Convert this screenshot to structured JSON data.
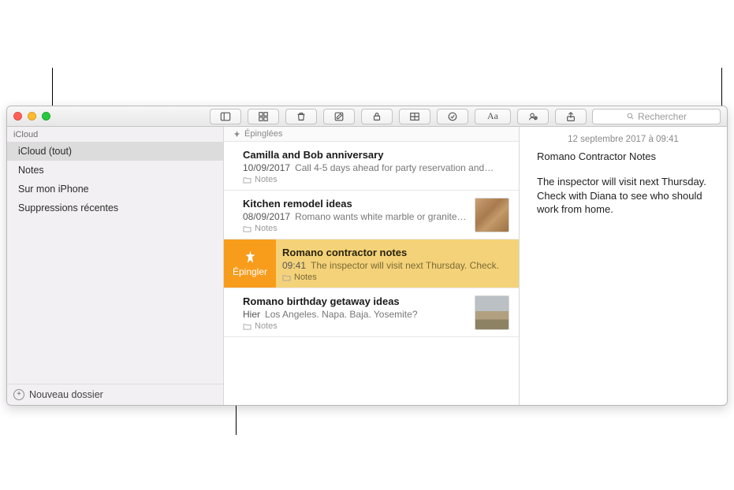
{
  "toolbar": {
    "search_placeholder": "Rechercher"
  },
  "sidebar": {
    "section_label": "iCloud",
    "items": [
      {
        "label": "iCloud (tout)",
        "selected": true
      },
      {
        "label": "Notes"
      },
      {
        "label": "Sur mon iPhone"
      },
      {
        "label": "Suppressions récentes"
      }
    ],
    "new_folder_label": "Nouveau dossier"
  },
  "list": {
    "pinned_header": "Épinglées",
    "items": [
      {
        "title": "Camilla and Bob anniversary",
        "date": "10/09/2017",
        "preview": "Call 4-5 days ahead for party reservation and…",
        "folder": "Notes"
      },
      {
        "title": "Kitchen remodel ideas",
        "date": "08/09/2017",
        "preview": "Romano wants white marble or granite…",
        "folder": "Notes",
        "thumb": "wood"
      },
      {
        "title": "Romano contractor notes",
        "date": "09:41",
        "preview": "The inspector will visit next Thursday. Check.",
        "folder": "Notes",
        "selected": true,
        "pin_action_label": "Épingler"
      },
      {
        "title": "Romano birthday getaway ideas",
        "date": "Hier",
        "preview": "Los Angeles. Napa. Baja. Yosemite?",
        "folder": "Notes",
        "thumb": "rocks"
      }
    ]
  },
  "detail": {
    "timestamp": "12 septembre 2017 à 09:41",
    "title": "Romano Contractor Notes",
    "body": "The inspector will visit next Thursday. Check with Diana to see who should work from home."
  }
}
